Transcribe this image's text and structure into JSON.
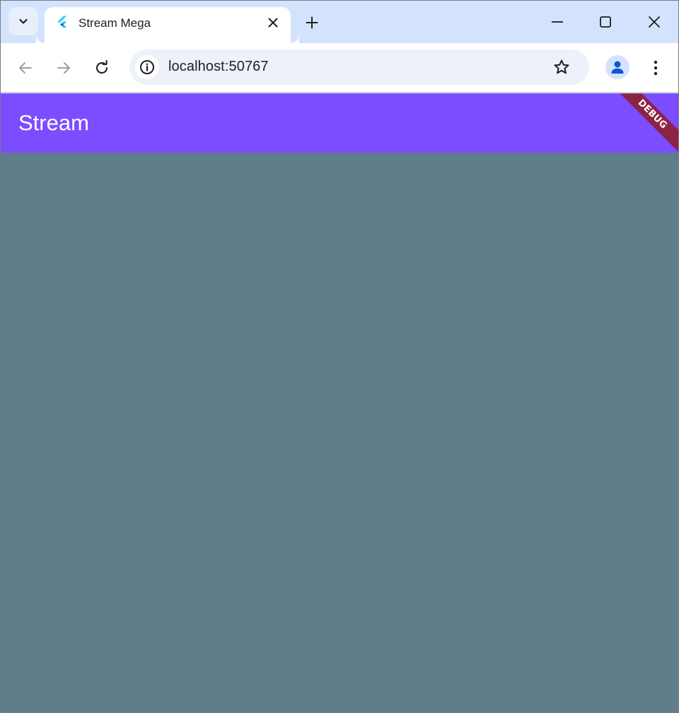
{
  "browser": {
    "tab": {
      "title": "Stream Mega",
      "favicon": "flutter-icon"
    },
    "address_bar": {
      "url": "localhost:50767"
    },
    "colors": {
      "tabstrip": "#d3e3fd",
      "omnibox": "#edf2fa"
    }
  },
  "app": {
    "appbar": {
      "title": "Stream"
    },
    "debug_banner": "DEBUG",
    "colors": {
      "appbar": "#7c4dff",
      "body": "#607d8b",
      "debug_banner": "#8b2346"
    }
  }
}
